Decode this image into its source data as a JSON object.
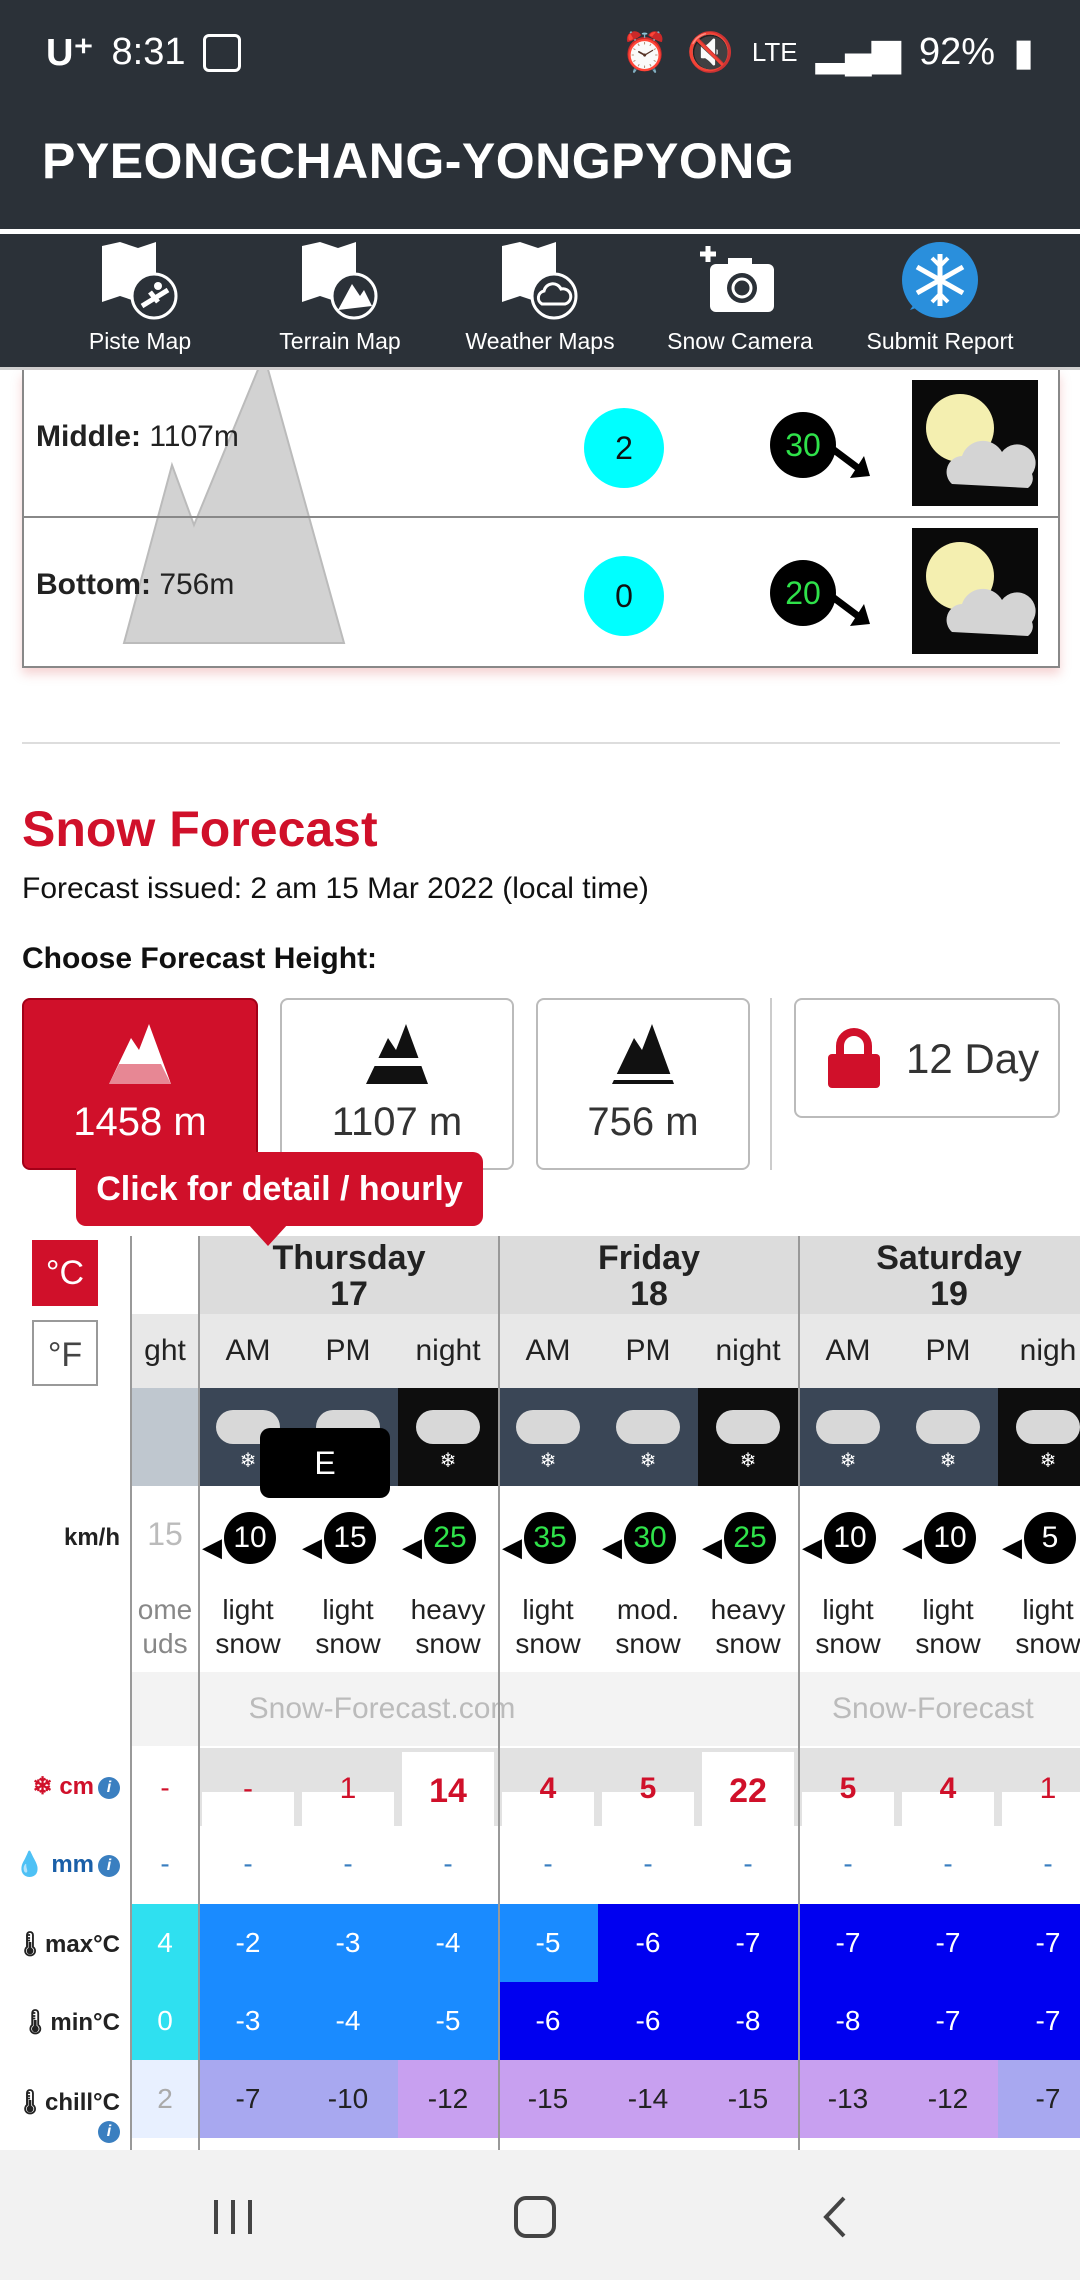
{
  "status_bar": {
    "carrier": "U⁺",
    "time": "8:31",
    "network": "LTE",
    "battery": "92%"
  },
  "header": {
    "title": "PYEONGCHANG-YONGPYONG"
  },
  "nav": [
    {
      "label": "Piste Map",
      "icon": "piste-map-icon"
    },
    {
      "label": "Terrain Map",
      "icon": "terrain-map-icon"
    },
    {
      "label": "Weather Maps",
      "icon": "weather-maps-icon"
    },
    {
      "label": "Snow Camera",
      "icon": "snow-camera-icon"
    },
    {
      "label": "Submit Report",
      "icon": "snowflake-icon"
    }
  ],
  "elevations": [
    {
      "label": "Middle:",
      "height": "1107m",
      "snow": "2",
      "wind": "30"
    },
    {
      "label": "Bottom:",
      "height": "756m",
      "snow": "0",
      "wind": "20"
    }
  ],
  "forecast": {
    "title": "Snow Forecast",
    "issued": "Forecast issued: 2 am  15 Mar 2022 (local time)",
    "choose_label": "Choose Forecast Height:",
    "heights": [
      "1458 m",
      "1107 m",
      "756 m"
    ],
    "selected_height": "1458 m",
    "day_button": "12 Day",
    "tooltip": "Click for detail / hourly",
    "wind_tooltip": "E",
    "units": {
      "celsius": "°C",
      "fahrenheit": "°F",
      "wind": "km/h"
    },
    "row_labels": {
      "snow": "cm",
      "rain": "mm",
      "max": "max°C",
      "min": "min°C",
      "chill": "chill°C"
    },
    "watermark": "Snow-Forecast.com",
    "watermark_partial": "Snow-Forecast",
    "prev_col": {
      "period": "ght",
      "wind": "15",
      "desc1": "ome",
      "desc2": "uds",
      "snow": "-",
      "rain": "-",
      "max": "4",
      "min": "0",
      "chill": "2"
    },
    "days": [
      {
        "name": "Thursday",
        "date": "17"
      },
      {
        "name": "Friday",
        "date": "18"
      },
      {
        "name": "Saturday",
        "date": "19"
      }
    ],
    "periods": [
      {
        "period": "AM",
        "wind": "10",
        "desc1": "light",
        "desc2": "snow",
        "snow": "-",
        "rain": "-",
        "max": "-2",
        "min": "-3",
        "chill": "-7"
      },
      {
        "period": "PM",
        "wind": "15",
        "desc1": "light",
        "desc2": "snow",
        "snow": "1",
        "rain": "-",
        "max": "-3",
        "min": "-4",
        "chill": "-10"
      },
      {
        "period": "night",
        "wind": "25",
        "desc1": "heavy",
        "desc2": "snow",
        "snow": "14",
        "rain": "-",
        "max": "-4",
        "min": "-5",
        "chill": "-12"
      },
      {
        "period": "AM",
        "wind": "35",
        "desc1": "light",
        "desc2": "snow",
        "snow": "4",
        "rain": "-",
        "max": "-5",
        "min": "-6",
        "chill": "-15"
      },
      {
        "period": "PM",
        "wind": "30",
        "desc1": "mod.",
        "desc2": "snow",
        "snow": "5",
        "rain": "-",
        "max": "-6",
        "min": "-6",
        "chill": "-14"
      },
      {
        "period": "night",
        "wind": "25",
        "desc1": "heavy",
        "desc2": "snow",
        "snow": "22",
        "rain": "-",
        "max": "-7",
        "min": "-8",
        "chill": "-15"
      },
      {
        "period": "AM",
        "wind": "10",
        "desc1": "light",
        "desc2": "snow",
        "snow": "5",
        "rain": "-",
        "max": "-7",
        "min": "-8",
        "chill": "-13"
      },
      {
        "period": "PM",
        "wind": "10",
        "desc1": "light",
        "desc2": "snow",
        "snow": "4",
        "rain": "-",
        "max": "-7",
        "min": "-7",
        "chill": "-12"
      },
      {
        "period": "nigh",
        "wind": "5",
        "desc1": "light",
        "desc2": "snow",
        "snow": "1",
        "rain": "-",
        "max": "-7",
        "min": "-7",
        "chill": "-7"
      }
    ]
  },
  "colors": {
    "accent": "#d0102a",
    "header_bg": "#2b3138",
    "snow_circle": "#00ffff",
    "wind_text": "#2fe24a"
  }
}
